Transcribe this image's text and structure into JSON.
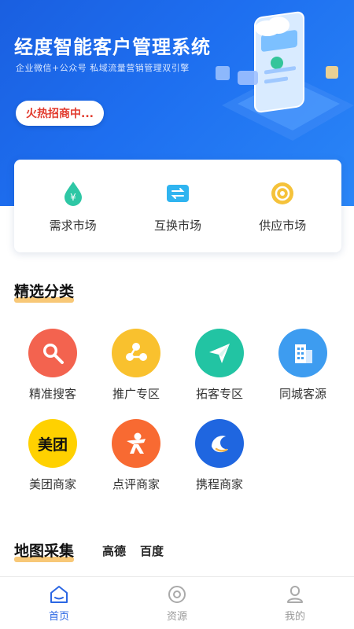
{
  "banner": {
    "title": "经度智能客户管理系统",
    "subtitle": "企业微信+公众号 私域流量营销管理双引擎",
    "cta_label": "火热招商中..."
  },
  "markets": [
    {
      "label": "需求市场",
      "icon": "money-drop-icon",
      "color": "#2ec7a5"
    },
    {
      "label": "互换市场",
      "icon": "exchange-icon",
      "color": "#2fb4f0"
    },
    {
      "label": "供应市场",
      "icon": "coin-icon",
      "color": "#f5c23a"
    }
  ],
  "categories_section": {
    "title": "精选分类",
    "items": [
      {
        "label": "精准搜客",
        "icon": "search-icon",
        "color": "#f3634f"
      },
      {
        "label": "推广专区",
        "icon": "share-icon",
        "color": "#f9c12e"
      },
      {
        "label": "拓客专区",
        "icon": "send-icon",
        "color": "#22c4a3"
      },
      {
        "label": "同城客源",
        "icon": "building-icon",
        "color": "#3d9cf0"
      },
      {
        "label": "美团商家",
        "icon": "meituan-logo",
        "color": "#ffd100",
        "logo_text": "美团"
      },
      {
        "label": "点评商家",
        "icon": "dianping-logo",
        "color": "#f86a32"
      },
      {
        "label": "携程商家",
        "icon": "ctrip-logo",
        "color": "#1f66e0"
      }
    ]
  },
  "map_section": {
    "title": "地图采集",
    "tabs": [
      "高德",
      "百度"
    ]
  },
  "bottom_nav": [
    {
      "label": "首页",
      "icon": "home-icon",
      "active": true
    },
    {
      "label": "资源",
      "icon": "resource-icon",
      "active": false
    },
    {
      "label": "我的",
      "icon": "user-icon",
      "active": false
    }
  ],
  "colors": {
    "primary": "#1e6ff0",
    "accent": "#f5b54a",
    "cta_text": "#e23b2e"
  }
}
